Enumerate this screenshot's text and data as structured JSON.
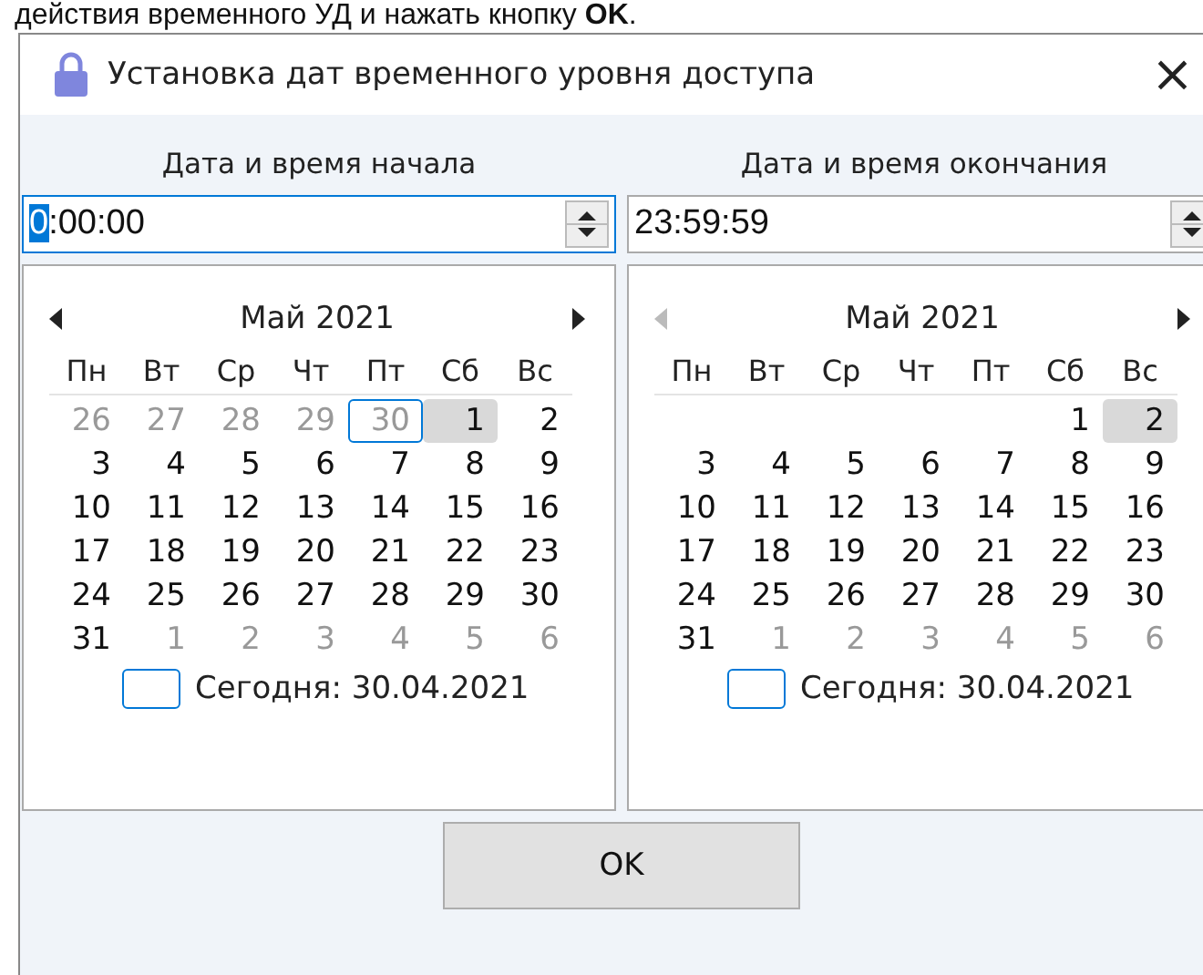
{
  "caption": "действия временного УД и нажать кнопку **OK**.",
  "window": {
    "title": "Установка дат временного уровня доступа",
    "close": "×"
  },
  "pickers": [
    {
      "label": "Дата и время начала",
      "time": {
        "value": "0:00:00",
        "focused": true
      },
      "calendar": {
        "month": "Май 2021",
        "prev_disabled": false,
        "weekdays": [
          "Пн",
          "Вт",
          "Ср",
          "Чт",
          "Пт",
          "Сб",
          "Вс"
        ],
        "today_text": "Сегодня: 30.04.2021",
        "weeks": [
          [
            {
              "text": "26",
              "other_month": true,
              "today": false,
              "selected": false
            },
            {
              "text": "27",
              "other_month": true,
              "today": false,
              "selected": false
            },
            {
              "text": "28",
              "other_month": true,
              "today": false,
              "selected": false
            },
            {
              "text": "29",
              "other_month": true,
              "today": false,
              "selected": false
            },
            {
              "text": "30",
              "other_month": true,
              "today": true,
              "selected": false
            },
            {
              "text": "1",
              "other_month": false,
              "today": false,
              "selected": true
            },
            {
              "text": "2",
              "other_month": false,
              "today": false,
              "selected": false
            }
          ],
          [
            {
              "text": "3",
              "other_month": false,
              "today": false,
              "selected": false
            },
            {
              "text": "4",
              "other_month": false,
              "today": false,
              "selected": false
            },
            {
              "text": "5",
              "other_month": false,
              "today": false,
              "selected": false
            },
            {
              "text": "6",
              "other_month": false,
              "today": false,
              "selected": false
            },
            {
              "text": "7",
              "other_month": false,
              "today": false,
              "selected": false
            },
            {
              "text": "8",
              "other_month": false,
              "today": false,
              "selected": false
            },
            {
              "text": "9",
              "other_month": false,
              "today": false,
              "selected": false
            }
          ],
          [
            {
              "text": "10",
              "other_month": false,
              "today": false,
              "selected": false
            },
            {
              "text": "11",
              "other_month": false,
              "today": false,
              "selected": false
            },
            {
              "text": "12",
              "other_month": false,
              "today": false,
              "selected": false
            },
            {
              "text": "13",
              "other_month": false,
              "today": false,
              "selected": false
            },
            {
              "text": "14",
              "other_month": false,
              "today": false,
              "selected": false
            },
            {
              "text": "15",
              "other_month": false,
              "today": false,
              "selected": false
            },
            {
              "text": "16",
              "other_month": false,
              "today": false,
              "selected": false
            }
          ],
          [
            {
              "text": "17",
              "other_month": false,
              "today": false,
              "selected": false
            },
            {
              "text": "18",
              "other_month": false,
              "today": false,
              "selected": false
            },
            {
              "text": "19",
              "other_month": false,
              "today": false,
              "selected": false
            },
            {
              "text": "20",
              "other_month": false,
              "today": false,
              "selected": false
            },
            {
              "text": "21",
              "other_month": false,
              "today": false,
              "selected": false
            },
            {
              "text": "22",
              "other_month": false,
              "today": false,
              "selected": false
            },
            {
              "text": "23",
              "other_month": false,
              "today": false,
              "selected": false
            }
          ],
          [
            {
              "text": "24",
              "other_month": false,
              "today": false,
              "selected": false
            },
            {
              "text": "25",
              "other_month": false,
              "today": false,
              "selected": false
            },
            {
              "text": "26",
              "other_month": false,
              "today": false,
              "selected": false
            },
            {
              "text": "27",
              "other_month": false,
              "today": false,
              "selected": false
            },
            {
              "text": "28",
              "other_month": false,
              "today": false,
              "selected": false
            },
            {
              "text": "29",
              "other_month": false,
              "today": false,
              "selected": false
            },
            {
              "text": "30",
              "other_month": false,
              "today": false,
              "selected": false
            }
          ],
          [
            {
              "text": "31",
              "other_month": false,
              "today": false,
              "selected": false
            },
            {
              "text": "1",
              "other_month": true,
              "today": false,
              "selected": false
            },
            {
              "text": "2",
              "other_month": true,
              "today": false,
              "selected": false
            },
            {
              "text": "3",
              "other_month": true,
              "today": false,
              "selected": false
            },
            {
              "text": "4",
              "other_month": true,
              "today": false,
              "selected": false
            },
            {
              "text": "5",
              "other_month": true,
              "today": false,
              "selected": false
            },
            {
              "text": "6",
              "other_month": true,
              "today": false,
              "selected": false
            }
          ]
        ]
      }
    },
    {
      "label": "Дата и время окончания",
      "time": {
        "value": "23:59:59",
        "focused": false
      },
      "calendar": {
        "month": "Май 2021",
        "prev_disabled": true,
        "weekdays": [
          "Пн",
          "Вт",
          "Ср",
          "Чт",
          "Пт",
          "Сб",
          "Вс"
        ],
        "today_text": "Сегодня: 30.04.2021",
        "weeks": [
          [
            {
              "text": "1",
              "other_month": false,
              "today": false,
              "selected": false
            },
            {
              "text": "2",
              "other_month": false,
              "today": false,
              "selected": true
            }
          ],
          [
            {
              "text": "3",
              "other_month": false,
              "today": false,
              "selected": false
            },
            {
              "text": "4",
              "other_month": false,
              "today": false,
              "selected": false
            },
            {
              "text": "5",
              "other_month": false,
              "today": false,
              "selected": false
            },
            {
              "text": "6",
              "other_month": false,
              "today": false,
              "selected": false
            },
            {
              "text": "7",
              "other_month": false,
              "today": false,
              "selected": false
            },
            {
              "text": "8",
              "other_month": false,
              "today": false,
              "selected": false
            },
            {
              "text": "9",
              "other_month": false,
              "today": false,
              "selected": false
            }
          ],
          [
            {
              "text": "10",
              "other_month": false,
              "today": false,
              "selected": false
            },
            {
              "text": "11",
              "other_month": false,
              "today": false,
              "selected": false
            },
            {
              "text": "12",
              "other_month": false,
              "today": false,
              "selected": false
            },
            {
              "text": "13",
              "other_month": false,
              "today": false,
              "selected": false
            },
            {
              "text": "14",
              "other_month": false,
              "today": false,
              "selected": false
            },
            {
              "text": "15",
              "other_month": false,
              "today": false,
              "selected": false
            },
            {
              "text": "16",
              "other_month": false,
              "today": false,
              "selected": false
            }
          ],
          [
            {
              "text": "17",
              "other_month": false,
              "today": false,
              "selected": false
            },
            {
              "text": "18",
              "other_month": false,
              "today": false,
              "selected": false
            },
            {
              "text": "19",
              "other_month": false,
              "today": false,
              "selected": false
            },
            {
              "text": "20",
              "other_month": false,
              "today": false,
              "selected": false
            },
            {
              "text": "21",
              "other_month": false,
              "today": false,
              "selected": false
            },
            {
              "text": "22",
              "other_month": false,
              "today": false,
              "selected": false
            },
            {
              "text": "23",
              "other_month": false,
              "today": false,
              "selected": false
            }
          ],
          [
            {
              "text": "24",
              "other_month": false,
              "today": false,
              "selected": false
            },
            {
              "text": "25",
              "other_month": false,
              "today": false,
              "selected": false
            },
            {
              "text": "26",
              "other_month": false,
              "today": false,
              "selected": false
            },
            {
              "text": "27",
              "other_month": false,
              "today": false,
              "selected": false
            },
            {
              "text": "28",
              "other_month": false,
              "today": false,
              "selected": false
            },
            {
              "text": "29",
              "other_month": false,
              "today": false,
              "selected": false
            },
            {
              "text": "30",
              "other_month": false,
              "today": false,
              "selected": false
            }
          ],
          [
            {
              "text": "31",
              "other_month": false,
              "today": false,
              "selected": false
            },
            {
              "text": "1",
              "other_month": true,
              "today": false,
              "selected": false
            },
            {
              "text": "2",
              "other_month": true,
              "today": false,
              "selected": false
            },
            {
              "text": "3",
              "other_month": true,
              "today": false,
              "selected": false
            },
            {
              "text": "4",
              "other_month": true,
              "today": false,
              "selected": false
            },
            {
              "text": "5",
              "other_month": true,
              "today": false,
              "selected": false
            },
            {
              "text": "6",
              "other_month": true,
              "today": false,
              "selected": false
            }
          ]
        ]
      }
    }
  ],
  "buttons": [
    "OK"
  ]
}
